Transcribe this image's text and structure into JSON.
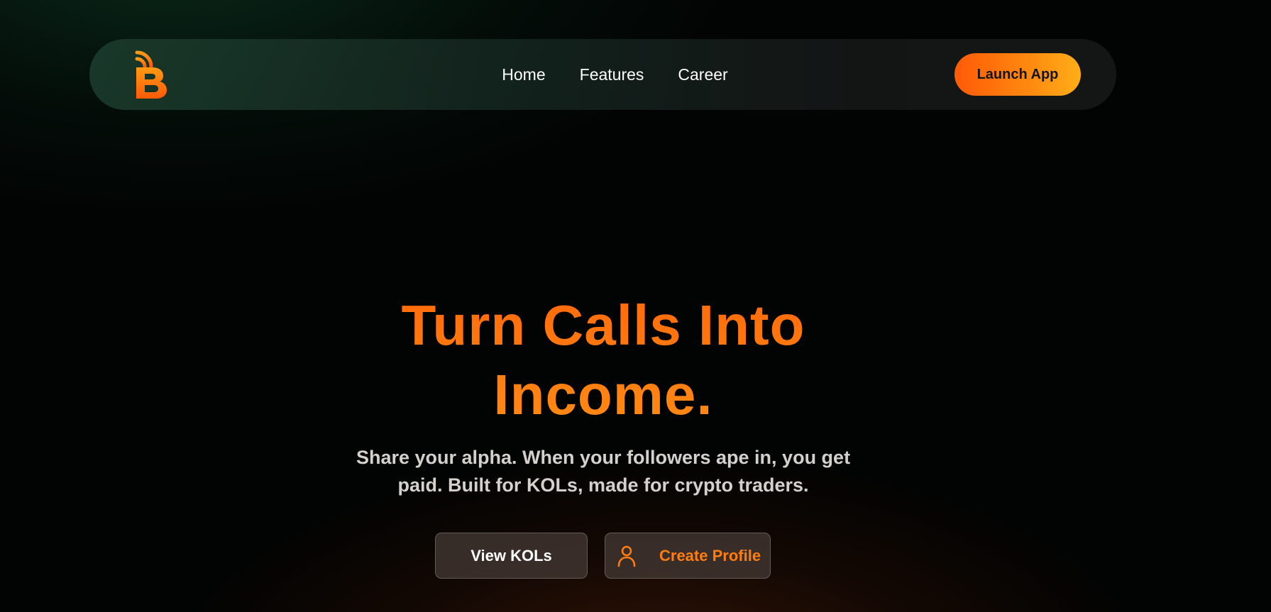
{
  "nav": {
    "logo_icon": "rss-b-logo-icon",
    "links": [
      "Home",
      "Features",
      "Career"
    ],
    "launch_label": "Launch App"
  },
  "hero": {
    "title_line1": "Turn Calls Into",
    "title_line2": "Income.",
    "subtitle_line1": "Share your alpha. When your followers ape in, you get",
    "subtitle_line2": "paid. Built for KOLs, made for crypto traders.",
    "view_kols_label": "View KOLs",
    "create_profile_label": "Create Profile",
    "create_profile_icon": "user-icon"
  },
  "colors": {
    "accent_orange": "#ff6a0a",
    "accent_yellow": "#ffae18",
    "nav_bg": "#1c3e2e",
    "text_light": "#d4d0cc"
  }
}
